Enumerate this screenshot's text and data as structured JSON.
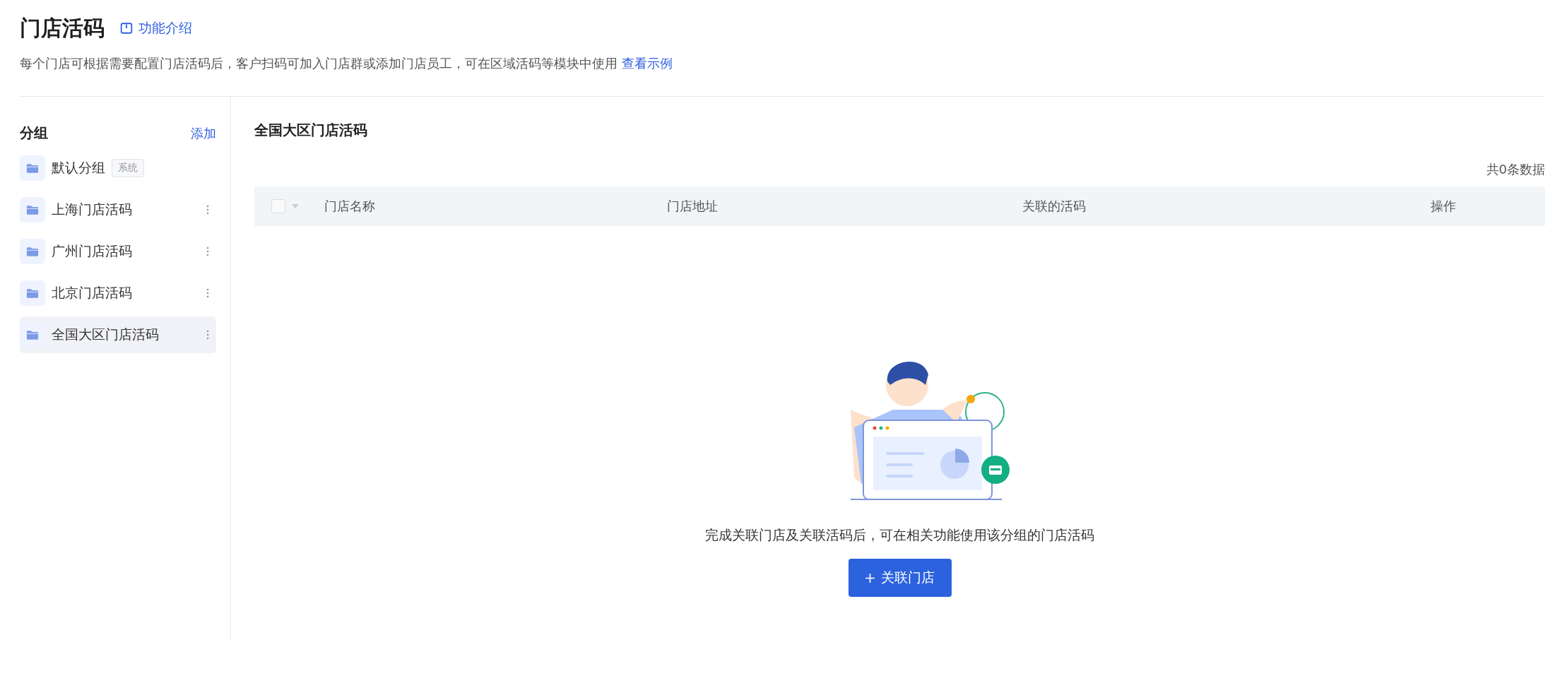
{
  "header": {
    "title": "门店活码",
    "intro_link": "功能介绍",
    "description": "每个门店可根据需要配置门店活码后，客户扫码可加入门店群或添加门店员工，可在区域活码等模块中使用",
    "example_link": "查看示例"
  },
  "sidebar": {
    "title": "分组",
    "add_label": "添加",
    "items": [
      {
        "label": "默认分组",
        "tag": "系统",
        "menu": false,
        "selected": false
      },
      {
        "label": "上海门店活码",
        "menu": true,
        "selected": false
      },
      {
        "label": "广州门店活码",
        "menu": true,
        "selected": false
      },
      {
        "label": "北京门店活码",
        "menu": true,
        "selected": false
      },
      {
        "label": "全国大区门店活码",
        "menu": true,
        "selected": true
      }
    ]
  },
  "main": {
    "title": "全国大区门店活码",
    "total": "共0条数据",
    "table": {
      "select_all_checked": false,
      "columns": [
        "门店名称",
        "门店地址",
        "关联的活码",
        "操作"
      ]
    },
    "empty": {
      "message": "完成关联门店及关联活码后，可在相关功能使用该分组的门店活码",
      "button": "关联门店"
    }
  }
}
